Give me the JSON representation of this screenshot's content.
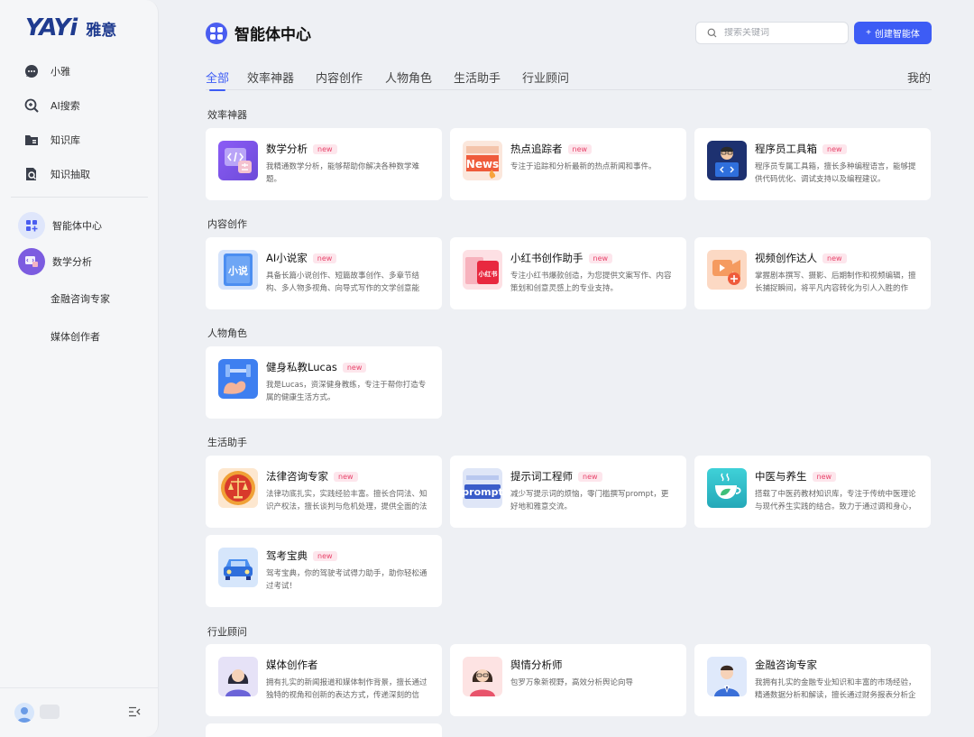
{
  "sidebar": {
    "logo_brand": "YAYi",
    "logo_cn": "雅意",
    "items": [
      {
        "label": "小雅",
        "icon": "chat-bubble-icon"
      },
      {
        "label": "AI搜索",
        "icon": "ai-search-icon"
      },
      {
        "label": "知识库",
        "icon": "folder-icon"
      },
      {
        "label": "知识抽取",
        "icon": "document-search-icon"
      }
    ],
    "agent_center": {
      "label": "智能体中心",
      "icon": "grid-apps-icon"
    },
    "recent": [
      {
        "label": "数学分析",
        "icon": "math-agent-avatar"
      },
      {
        "label": "金融咨询专家"
      },
      {
        "label": "媒体创作者"
      }
    ]
  },
  "header": {
    "title": "智能体中心",
    "search_placeholder": "搜索关键词",
    "create_label": "创建智能体",
    "create_icon": "+"
  },
  "tabs": [
    "全部",
    "效率神器",
    "内容创作",
    "人物角色",
    "生活助手",
    "行业顾问"
  ],
  "tab_mine": "我的",
  "badge_text": "new",
  "sections": [
    {
      "title": "效率神器",
      "cards": [
        {
          "name": "数学分析",
          "desc": "我精通数学分析，能够帮助你解决各种数学难题。",
          "icon": "math-code-icon"
        },
        {
          "name": "热点追踪者",
          "desc": "专注于追踪和分析最新的热点新闻和事件。",
          "icon": "news-icon"
        },
        {
          "name": "程序员工具箱",
          "desc": "程序员专属工具箱，擅长多种编程语言，能够提供代码优化、调试支持以及编程建议。",
          "icon": "programmer-icon"
        }
      ]
    },
    {
      "title": "内容创作",
      "cards": [
        {
          "name": "AI小说家",
          "desc": "具备长篇小说创作、短篇故事创作、多章节结构、多人物多视角、向导式写作的文学创意能力。",
          "icon": "novel-book-icon"
        },
        {
          "name": "小红书创作助手",
          "desc": "专注小红书爆款创造，为您提供文案写作、内容策划和创意灵感上的专业支持。",
          "icon": "xiaohongshu-icon"
        },
        {
          "name": "视频创作达人",
          "desc": "掌握剧本撰写、摄影、后期制作和视频编辑，擅长捕捉瞬间，将平凡内容转化为引人入胜的作品。",
          "icon": "video-camera-icon"
        }
      ]
    },
    {
      "title": "人物角色",
      "cards": [
        {
          "name": "健身私教Lucas",
          "desc": "我是Lucas，资深健身教练，专注于帮你打造专属的健康生活方式。",
          "icon": "fitness-dumbbell-icon"
        }
      ]
    },
    {
      "title": "生活助手",
      "cards": [
        {
          "name": "法律咨询专家",
          "desc": "法律功底扎实，实践经验丰富。擅长合同法、知识产权法，擅长谈判与危机处理，提供全面的法律服务。",
          "icon": "law-scale-icon"
        },
        {
          "name": "提示词工程师",
          "desc": "减少写提示词的烦恼，零门槛撰写prompt，更好地和雅意交流。",
          "icon": "prompt-icon"
        },
        {
          "name": "中医与养生",
          "desc": "搭载了中医药教材知识库，专注于传统中医理论与现代养生实践的结合。致力于通过调和身心，促进健康。",
          "icon": "tea-cup-icon"
        },
        {
          "name": "驾考宝典",
          "desc": "驾考宝典，你的驾驶考试得力助手，助你轻松通过考试！",
          "icon": "car-icon"
        }
      ]
    },
    {
      "title": "行业顾问",
      "cards": [
        {
          "name": "媒体创作者",
          "desc": "拥有扎实的新闻报道和媒体制作背景，擅长通过独特的视角和创新的表达方式，传递深刻的信息。",
          "icon": "woman-avatar-icon"
        },
        {
          "name": "舆情分析师",
          "desc": "包罗万象新视野，高效分析舆论向导",
          "icon": "analyst-avatar-icon"
        },
        {
          "name": "金融咨询专家",
          "desc": "我拥有扎实的金融专业知识和丰富的市场经验，精通数据分析和解读，擅长通过财务报表分析企业状况。",
          "icon": "finance-man-avatar-icon"
        }
      ]
    }
  ]
}
